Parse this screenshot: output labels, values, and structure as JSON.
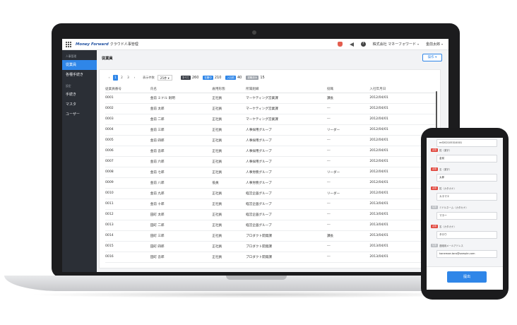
{
  "app": {
    "logo": "Money Forward",
    "product": "クラウド人事管理"
  },
  "topbar": {
    "help_glyph": "?",
    "company": "株式会社 マネーフォワード",
    "user": "金前太郎",
    "caret": "▾"
  },
  "sidebar": {
    "group1": "人事管理",
    "items1": [
      "従業員",
      "各種手続き"
    ],
    "group2": "設定",
    "items2": [
      "手続き",
      "マスタ",
      "ユーザー"
    ]
  },
  "main": {
    "title": "従業員",
    "action_button": "操作 ▾",
    "pager": {
      "prev": "‹",
      "pages": [
        "1",
        "2",
        "3"
      ],
      "next": "›",
      "per_page_label": "表示件数",
      "per_page_value": "25件 ▾"
    },
    "filters": [
      {
        "label": "すべて",
        "count": "260",
        "color": "#3a3f47"
      },
      {
        "label": "在籍中",
        "count": "210",
        "color": "#2f86e8"
      },
      {
        "label": "入社前",
        "count": "40",
        "color": "#2f86e8"
      },
      {
        "label": "退職済み",
        "count": "15",
        "color": "#9aa0a8"
      }
    ],
    "columns": [
      "従業員番号",
      "氏名",
      "雇用形態",
      "所属組織",
      "役職",
      "入社年月日"
    ],
    "rows": [
      [
        "0001",
        "金前 ミドル 則明",
        "正社員",
        "マーケティング営業課",
        "課長",
        "2012/04/01"
      ],
      [
        "0002",
        "金前 太郎",
        "正社員",
        "マーケティング営業課",
        "---",
        "2012/04/01"
      ],
      [
        "0003",
        "金前 二郎",
        "正社員",
        "マーケティング営業課",
        "---",
        "2012/04/01"
      ],
      [
        "0004",
        "金前 三郎",
        "正社員",
        "人事採用グループ",
        "リーダー",
        "2012/04/01"
      ],
      [
        "0005",
        "金前 四郎",
        "正社員",
        "人事採用グループ",
        "---",
        "2012/04/01"
      ],
      [
        "0006",
        "金前 吾郎",
        "正社員",
        "人事採用グループ",
        "---",
        "2012/04/01"
      ],
      [
        "0007",
        "金前 六郎",
        "正社員",
        "人事採用グループ",
        "---",
        "2012/04/01"
      ],
      [
        "0008",
        "金前 七郎",
        "正社員",
        "人事労務グループ",
        "リーダー",
        "2012/04/01"
      ],
      [
        "0009",
        "金前 八郎",
        "役員",
        "人事労務グループ",
        "---",
        "2012/04/01"
      ],
      [
        "0010",
        "金前 九郎",
        "正社員",
        "経営企画グループ",
        "リーダー",
        "2012/04/01"
      ],
      [
        "0011",
        "金前 十郎",
        "正社員",
        "経営企画グループ",
        "---",
        "2013/04/01"
      ],
      [
        "0012",
        "田町 太郎",
        "正社員",
        "経営企画グループ",
        "---",
        "2013/04/01"
      ],
      [
        "0013",
        "田町 二郎",
        "正社員",
        "経営企画グループ",
        "---",
        "2013/04/01"
      ],
      [
        "0014",
        "田町 三郎",
        "正社員",
        "プロダクト開発課",
        "課長",
        "2013/04/01"
      ],
      [
        "0015",
        "田町 四郎",
        "正社員",
        "プロダクト開発課",
        "---",
        "2013/04/01"
      ],
      [
        "0016",
        "田町 吾郎",
        "正社員",
        "プロダクト開発課",
        "---",
        "2013/04/01"
      ]
    ]
  },
  "phone": {
    "fields": [
      {
        "tag": "",
        "tag_type": "",
        "label": "",
        "value": "mf202105310001"
      },
      {
        "tag": "必須",
        "tag_type": "req",
        "label": "姓（漢字）",
        "value": "金前"
      },
      {
        "tag": "必須",
        "tag_type": "req",
        "label": "名（漢字）",
        "value": "太郎"
      },
      {
        "tag": "必須",
        "tag_type": "req",
        "label": "姓（カタカナ）",
        "value": "カネマエ"
      },
      {
        "tag": "任意",
        "tag_type": "opt",
        "label": "ミドルネーム（カタカナ）",
        "value": "マネー"
      },
      {
        "tag": "必須",
        "tag_type": "req",
        "label": "名（カタカナ）",
        "value": "タロウ"
      },
      {
        "tag": "任意",
        "tag_type": "opt",
        "label": "連絡用メールアドレス",
        "value": "kanemae.taro@sample.com"
      }
    ],
    "submit": "提出"
  }
}
